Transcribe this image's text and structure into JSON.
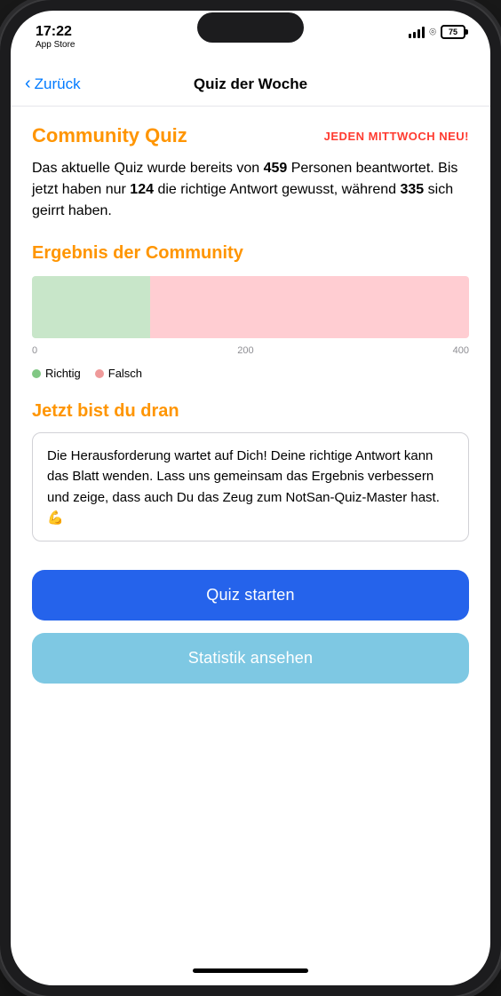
{
  "statusBar": {
    "time": "17:22",
    "subtitle": "App Store",
    "battery": "75"
  },
  "navBar": {
    "backLabel": "Zurück",
    "title": "Quiz der Woche"
  },
  "communityQuiz": {
    "title": "Community Quiz",
    "badge": "JEDEN MITTWOCH NEU!",
    "description_1": "Das aktuelle Quiz wurde bereits von ",
    "totalCount": "459",
    "description_2": " Personen beantwortet. Bis jetzt haben nur ",
    "correctCount": "124",
    "description_3": " die richtige Antwort gewusst, während ",
    "incorrectCount": "335",
    "description_4": " sich geirrt haben."
  },
  "chart": {
    "sectionTitle": "Ergebnis der Community",
    "correctValue": 124,
    "incorrectValue": 335,
    "totalValue": 459,
    "maxAxis": 400,
    "axisLabels": [
      "0",
      "200",
      "400"
    ],
    "legend": {
      "correctLabel": "Richtig",
      "incorrectLabel": "Falsch"
    }
  },
  "challenge": {
    "title": "Jetzt bist du dran",
    "text": "Die Herausforderung wartet auf Dich! Deine richtige Antwort kann das Blatt wenden. Lass uns gemeinsam das Ergebnis verbessern und zeige, dass auch Du das Zeug zum NotSan-Quiz-Master hast. 💪"
  },
  "buttons": {
    "primary": "Quiz starten",
    "secondary": "Statistik ansehen"
  },
  "colors": {
    "orange": "#ff9500",
    "red": "#ff3b30",
    "blue": "#2563eb",
    "lightBlue": "#7ec8e3",
    "correctBar": "#c8e6c9",
    "incorrectBar": "#ffcdd2",
    "correctDot": "#81c784",
    "incorrectDot": "#ef9a9a"
  }
}
